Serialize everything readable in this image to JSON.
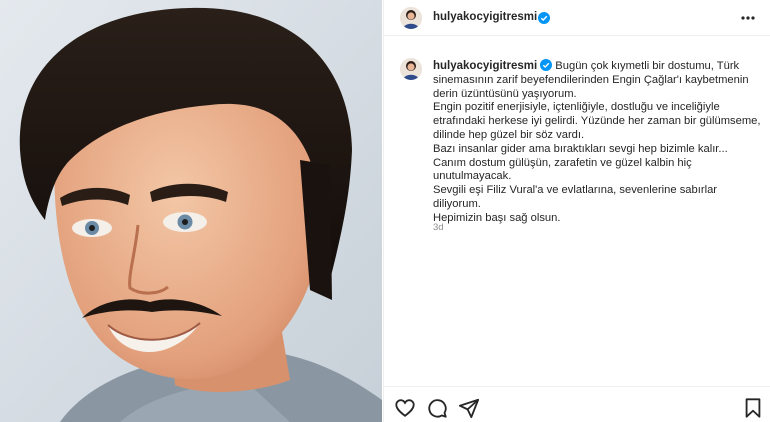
{
  "post": {
    "username": "hulyakocyigitresmi",
    "verified": true,
    "more_icon": "more-horizontal-icon",
    "caption_lines": [
      "Bugün çok kıymetli bir dostumu, Türk sinemasının zarif beyefendilerinden Engin Çağlar'ı kaybetmenin derin üzüntüsünü yaşıyorum.",
      "Engin pozitif enerjisiyle, içtenliğiyle, dostluğu ve inceliğiyle etrafındaki herkese iyi gelirdi. Yüzünde her zaman bir gülümseme, dilinde hep güzel bir söz vardı.",
      "Bazı insanlar gider ama bıraktıkları sevgi hep bizimle kalır...",
      "Canım dostum gülüşün, zarafetin ve güzel kalbin hiç unutulmayacak.",
      "Sevgili eşi Filiz Vural'a ve evlatlarına, sevenlerine sabırlar diliyorum.",
      "Hepimizin başı sağ olsun."
    ],
    "time_ago": "3d"
  },
  "actions": {
    "like_icon": "heart-icon",
    "comment_icon": "comment-icon",
    "share_icon": "send-icon",
    "save_icon": "bookmark-icon"
  },
  "colors": {
    "verified_blue": "#0095f6",
    "text": "#262626",
    "muted": "#8e8e8e",
    "border": "#efefef"
  }
}
